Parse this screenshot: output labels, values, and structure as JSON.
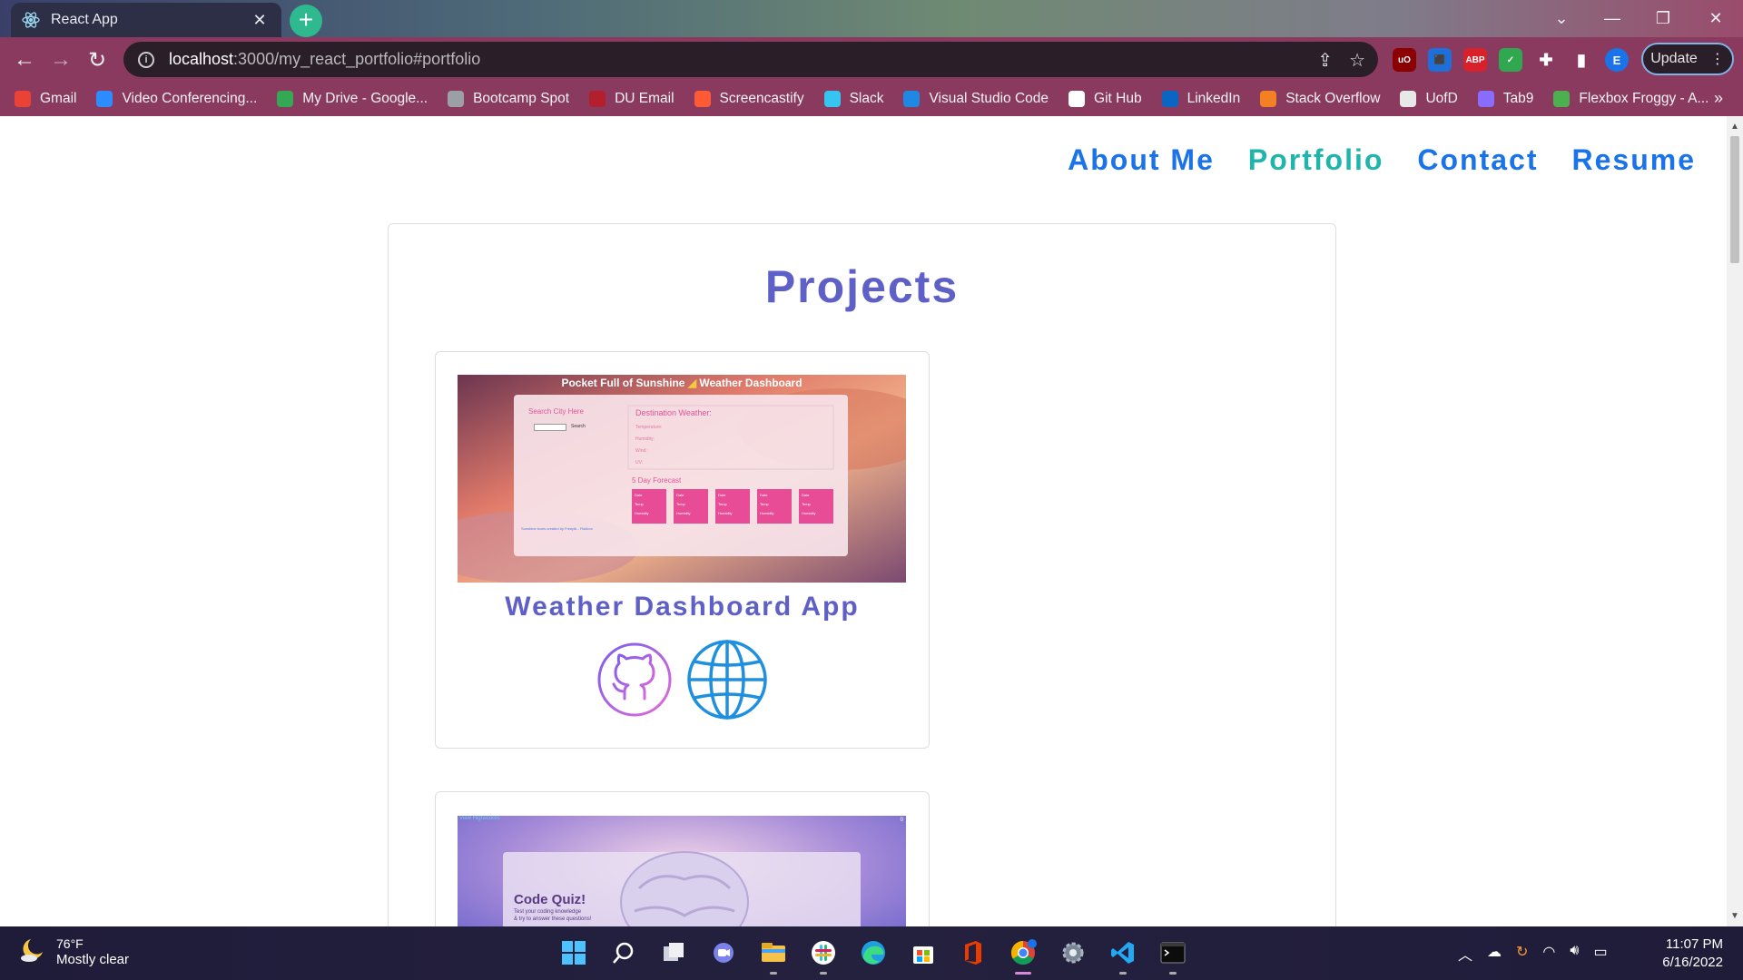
{
  "browser": {
    "tab_title": "React App",
    "url_host": "localhost",
    "url_path": ":3000/my_react_portfolio#portfolio",
    "update_label": "Update",
    "profile_initial": "E",
    "bookmarks": [
      {
        "label": "Gmail",
        "icon": "gmail-icon",
        "color": "#ea4335"
      },
      {
        "label": "Video Conferencing...",
        "icon": "zoom-icon",
        "color": "#2d8cff"
      },
      {
        "label": "My Drive - Google...",
        "icon": "google-drive-icon",
        "color": "#34a853"
      },
      {
        "label": "Bootcamp Spot",
        "icon": "bootcamp-icon",
        "color": "#9aa0a6"
      },
      {
        "label": "DU Email",
        "icon": "du-email-icon",
        "color": "#b41f2e"
      },
      {
        "label": "Screencastify",
        "icon": "screencastify-icon",
        "color": "#ff5a36"
      },
      {
        "label": "Slack",
        "icon": "slack-icon",
        "color": "#36c5f0"
      },
      {
        "label": "Visual Studio Code",
        "icon": "vscode-icon",
        "color": "#1e88e5"
      },
      {
        "label": "Git Hub",
        "icon": "github-icon",
        "color": "#ffffff"
      },
      {
        "label": "LinkedIn",
        "icon": "linkedin-icon",
        "color": "#0a66c2"
      },
      {
        "label": "Stack Overflow",
        "icon": "stackoverflow-icon",
        "color": "#f48024"
      },
      {
        "label": "UofD",
        "icon": "uofd-icon",
        "color": "#e8e8e8"
      },
      {
        "label": "Tab9",
        "icon": "tab9-icon",
        "color": "#8a6cff"
      },
      {
        "label": "Flexbox Froggy - A...",
        "icon": "froggy-icon",
        "color": "#4caf50"
      }
    ]
  },
  "site": {
    "nav": [
      {
        "label": "About Me",
        "active": false
      },
      {
        "label": "Portfolio",
        "active": true
      },
      {
        "label": "Contact",
        "active": false
      },
      {
        "label": "Resume",
        "active": false
      }
    ],
    "projects_heading": "Projects",
    "projects": [
      {
        "title": "Weather Dashboard App",
        "screenshot": {
          "header": "Pocket Full of Sunshine",
          "header_right": "Weather Dashboard",
          "search_label": "Search City Here",
          "search_button": "Search",
          "destination_label": "Destination Weather:",
          "destination_lines": [
            "Temperature:",
            "Humidity:",
            "Wind:",
            "UV:"
          ],
          "forecast_label": "5 Day Forecast",
          "forecast_cards": [
            [
              "Date",
              "Temp",
              "Humidity"
            ],
            [
              "Date",
              "Temp",
              "Humidity"
            ],
            [
              "Date",
              "Temp",
              "Humidity"
            ],
            [
              "Date",
              "Temp",
              "Humidity"
            ],
            [
              "Date",
              "Temp",
              "Humidity"
            ]
          ],
          "footer": "Sunshine icons created by Freepik - Flaticon"
        }
      },
      {
        "title": "",
        "screenshot": {
          "top_link": "View Highscores",
          "top_right": "0",
          "heading": "Code Quiz!",
          "subtext_1": "Test your coding knowledge",
          "subtext_2": "& try to answer these questions!"
        }
      }
    ]
  },
  "taskbar": {
    "temperature": "76°F",
    "condition": "Mostly clear",
    "time": "11:07 PM",
    "date": "6/16/2022"
  },
  "colors": {
    "nav_link": "#1a73e8",
    "nav_active": "#1fb5ad",
    "heading": "#5f5fc8",
    "chrome_toolbar": "#8a3a5e"
  }
}
